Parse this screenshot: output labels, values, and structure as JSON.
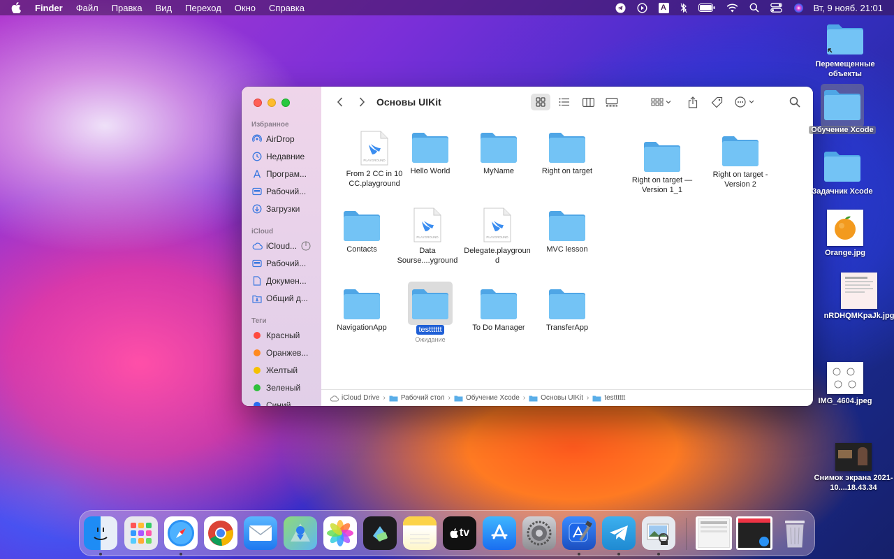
{
  "menubar": {
    "app": "Finder",
    "items": [
      "Файл",
      "Правка",
      "Вид",
      "Переход",
      "Окно",
      "Справка"
    ],
    "clock": "Вт, 9 нояб.  21:01",
    "input_indicator": "A"
  },
  "window": {
    "title": "Основы UIKit",
    "sidebar": {
      "favorites_header": "Избранное",
      "favorites": [
        {
          "label": "AirDrop",
          "icon": "airdrop-icon"
        },
        {
          "label": "Недавние",
          "icon": "clock-icon"
        },
        {
          "label": "Програм...",
          "icon": "applications-icon"
        },
        {
          "label": "Рабочий...",
          "icon": "desktop-icon"
        },
        {
          "label": "Загрузки",
          "icon": "downloads-icon"
        }
      ],
      "icloud_header": "iCloud",
      "icloud": [
        {
          "label": "iCloud...",
          "icon": "cloud-icon"
        },
        {
          "label": "Рабочий...",
          "icon": "desktop-icon"
        },
        {
          "label": "Докумен...",
          "icon": "document-icon"
        },
        {
          "label": "Общий д...",
          "icon": "shared-folder-icon"
        }
      ],
      "tags_header": "Теги",
      "tags": [
        {
          "label": "Красный",
          "color": "#ff4a3f"
        },
        {
          "label": "Оранжев...",
          "color": "#ff8a1f"
        },
        {
          "label": "Желтый",
          "color": "#f5c100"
        },
        {
          "label": "Зеленый",
          "color": "#2fbf3c"
        },
        {
          "label": "Синий",
          "color": "#2a6cf0"
        }
      ]
    },
    "items": [
      {
        "label": "From 2 CC in 10 CC.playground",
        "type": "playground",
        "badge": "PLAYGROUND"
      },
      {
        "label": "Hello World",
        "type": "folder"
      },
      {
        "label": "MyName",
        "type": "folder"
      },
      {
        "label": "Right on target",
        "type": "folder"
      },
      {
        "label": "Right on target — Version 1_1",
        "type": "folder"
      },
      {
        "label": "Right on target - Version 2",
        "type": "folder"
      },
      {
        "label": "Contacts",
        "type": "folder"
      },
      {
        "label": "Data Sourse....yground",
        "type": "playground",
        "badge": "PLAYGROUND"
      },
      {
        "label": "Delegate.playground",
        "type": "playground",
        "badge": "PLAYGROUND"
      },
      {
        "label": "MVC lesson",
        "type": "folder"
      },
      {
        "label": "NavigationApp",
        "type": "folder"
      },
      {
        "label": "testttttt",
        "type": "folder",
        "selected": true,
        "status": "Ожидание"
      },
      {
        "label": "To Do Manager",
        "type": "folder"
      },
      {
        "label": "TransferApp",
        "type": "folder"
      }
    ],
    "pathbar": [
      "iCloud Drive",
      "Рабочий стол",
      "Обучение Xcode",
      "Основы UIKit",
      "testttttt"
    ]
  },
  "desktop": [
    {
      "label": "Перемещенные объекты",
      "type": "folder"
    },
    {
      "label": "Обучение Xcode",
      "type": "folder",
      "selected": true
    },
    {
      "label": "Задачник Xcode",
      "type": "folder"
    },
    {
      "label": "Orange.jpg",
      "type": "image"
    },
    {
      "label": "nRDHQMKpaJk.jpg",
      "type": "image"
    },
    {
      "label": "IMG_4604.jpeg",
      "type": "image"
    },
    {
      "label": "Снимок экрана 2021-10....18.43.34",
      "type": "image"
    }
  ],
  "dock": {
    "apps": [
      "finder",
      "launchpad",
      "safari",
      "chrome",
      "mail",
      "maps",
      "photos",
      "xcode-tools",
      "notes",
      "tv",
      "app-store",
      "system-preferences",
      "xcode",
      "telegram",
      "preview"
    ],
    "tv_label": "tv"
  },
  "colors": {
    "folder_blue": "#6fc0f2",
    "selection_blue": "#1f5fd6"
  }
}
